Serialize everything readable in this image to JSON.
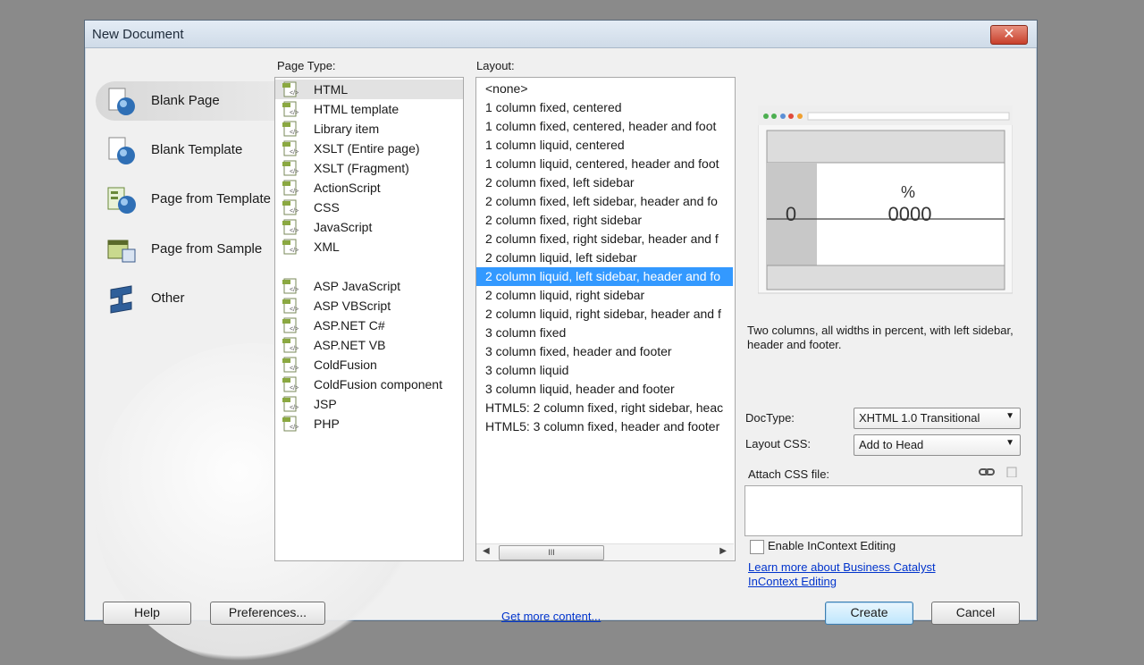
{
  "dialog": {
    "title": "New Document",
    "close_label": "✕"
  },
  "categories": [
    {
      "label": "Blank Page",
      "icon": "blank-page-icon",
      "selected": true
    },
    {
      "label": "Blank Template",
      "icon": "blank-template-icon",
      "selected": false
    },
    {
      "label": "Page from Template",
      "icon": "page-from-template-icon",
      "selected": false
    },
    {
      "label": "Page from Sample",
      "icon": "page-from-sample-icon",
      "selected": false
    },
    {
      "label": "Other",
      "icon": "other-icon",
      "selected": false
    }
  ],
  "page_type": {
    "label": "Page Type:",
    "items": [
      {
        "label": "HTML",
        "selected": true
      },
      {
        "label": "HTML template"
      },
      {
        "label": "Library item"
      },
      {
        "label": "XSLT (Entire page)"
      },
      {
        "label": "XSLT (Fragment)"
      },
      {
        "label": "ActionScript"
      },
      {
        "label": "CSS"
      },
      {
        "label": "JavaScript"
      },
      {
        "label": "XML"
      },
      {
        "label": "ASP JavaScript"
      },
      {
        "label": "ASP VBScript"
      },
      {
        "label": "ASP.NET C#"
      },
      {
        "label": "ASP.NET VB"
      },
      {
        "label": "ColdFusion"
      },
      {
        "label": "ColdFusion component"
      },
      {
        "label": "JSP"
      },
      {
        "label": "PHP"
      }
    ]
  },
  "layout": {
    "label": "Layout:",
    "items": [
      {
        "label": "<none>"
      },
      {
        "label": "1 column fixed, centered"
      },
      {
        "label": "1 column fixed, centered, header and foot"
      },
      {
        "label": "1 column liquid, centered"
      },
      {
        "label": "1 column liquid, centered, header and foot"
      },
      {
        "label": "2 column fixed, left sidebar"
      },
      {
        "label": "2 column fixed, left sidebar, header and fo"
      },
      {
        "label": "2 column fixed, right sidebar"
      },
      {
        "label": "2 column fixed, right sidebar, header and f"
      },
      {
        "label": "2 column liquid, left sidebar"
      },
      {
        "label": "2 column liquid, left sidebar, header and fo",
        "selected": true
      },
      {
        "label": "2 column liquid, right sidebar"
      },
      {
        "label": "2 column liquid, right sidebar, header and f"
      },
      {
        "label": "3 column fixed"
      },
      {
        "label": "3 column fixed, header and footer"
      },
      {
        "label": "3 column liquid"
      },
      {
        "label": "3 column liquid, header and footer"
      },
      {
        "label": "HTML5: 2 column fixed, right sidebar, heac"
      },
      {
        "label": "HTML5: 3 column fixed, header and footer"
      }
    ],
    "scroll_thumb_label": "III"
  },
  "preview": {
    "symbol_percent": "%",
    "symbol_left": "0",
    "symbol_right": "0000"
  },
  "description": "Two columns, all widths in percent, with left sidebar, header and footer.",
  "doctype": {
    "label": "DocType:",
    "value": "XHTML 1.0 Transitional"
  },
  "layout_css": {
    "label": "Layout CSS:",
    "value": "Add to Head"
  },
  "attach_css": {
    "label": "Attach CSS file:"
  },
  "incontext": {
    "label": "Enable InContext Editing",
    "checked": false
  },
  "learn_more": {
    "line1": "Learn more about Business Catalyst",
    "line2": "InContext Editing"
  },
  "footer": {
    "help": "Help",
    "preferences": "Preferences...",
    "get_more": "Get more content...",
    "create": "Create",
    "cancel": "Cancel"
  },
  "colors": {
    "selection": "#3399ff",
    "link": "#0033cc"
  }
}
